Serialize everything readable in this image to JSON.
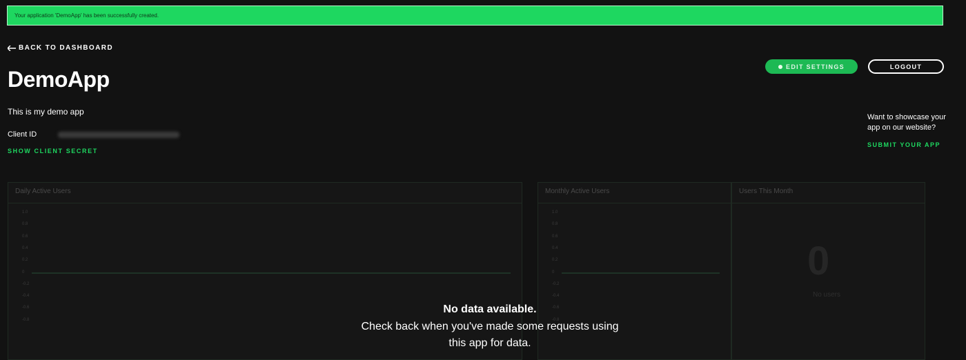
{
  "banner": {
    "message": "Your application 'DemoApp' has been successfully created."
  },
  "nav": {
    "back_label": "BACK TO DASHBOARD",
    "back_icon": "arrow-left-icon"
  },
  "app": {
    "name": "DemoApp",
    "description": "This is my demo app",
    "client_id_label": "Client ID",
    "show_secret_label": "SHOW CLIENT SECRET"
  },
  "actions": {
    "edit_settings_label": "EDIT SETTINGS",
    "logout_label": "LOGOUT"
  },
  "showcase": {
    "text": "Want to showcase your app on our website?",
    "submit_label": "SUBMIT YOUR APP"
  },
  "colors": {
    "accent": "#1ed760",
    "background": "#121212",
    "banner": "#1ed760"
  },
  "panels": {
    "daily": {
      "title": "Daily Active Users"
    },
    "monthly": {
      "title": "Monthly Active Users"
    },
    "users_month": {
      "title": "Users This Month",
      "count": "0",
      "caption": "No users"
    }
  },
  "chart_data": [
    {
      "type": "line",
      "title": "Daily Active Users",
      "y_ticks": [
        "1.0",
        "0.8",
        "0.6",
        "0.4",
        "0.2",
        "0",
        "-0.2",
        "-0.4",
        "-0.6",
        "-0.8"
      ],
      "ylim": [
        -0.8,
        1.0
      ],
      "series": [
        {
          "values": [
            0
          ]
        }
      ]
    },
    {
      "type": "line",
      "title": "Monthly Active Users",
      "y_ticks": [
        "1.0",
        "0.8",
        "0.6",
        "0.4",
        "0.2",
        "0",
        "-0.2",
        "-0.4",
        "-0.6",
        "-0.8"
      ],
      "ylim": [
        -0.8,
        1.0
      ],
      "series": [
        {
          "values": [
            0
          ]
        }
      ]
    }
  ],
  "empty_state": {
    "heading": "No data available.",
    "body": "Check back when you've made some requests using this app for data."
  }
}
